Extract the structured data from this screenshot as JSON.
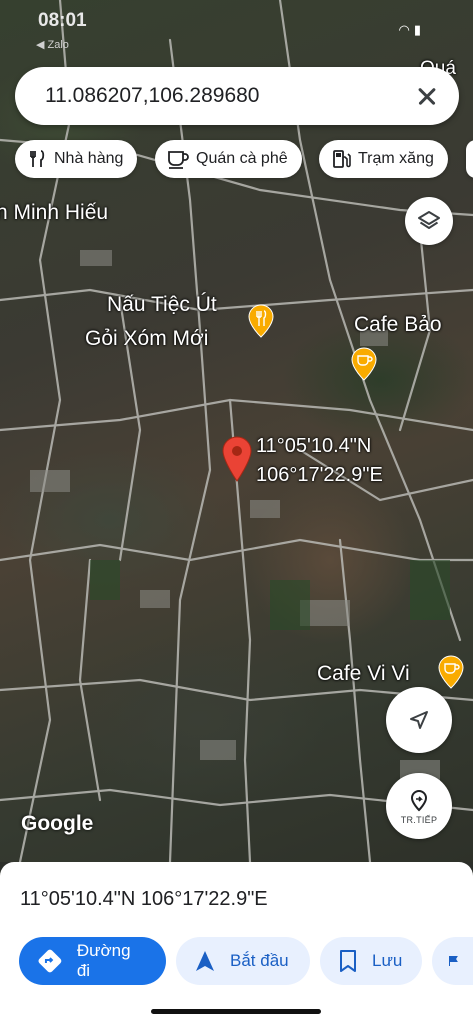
{
  "status": {
    "time": "08:01",
    "sub": "◀ Zalo"
  },
  "search": {
    "query": "11.086207,106.289680"
  },
  "chips": [
    {
      "label": "Nhà hàng",
      "icon": "restaurant-icon"
    },
    {
      "label": "Quán cà phê",
      "icon": "coffee-icon"
    },
    {
      "label": "Trạm xăng",
      "icon": "gas-station-icon"
    }
  ],
  "map": {
    "labels": {
      "minh_hieu": "n Minh Hiếu",
      "nau_tiec_line1": "Nấu Tiệc Út",
      "nau_tiec_line2": "Gỏi Xóm Mới",
      "cafe_bao": "Cafe Bảo",
      "cafe_vivi": "Cafe Vi Vi",
      "top_right": "Quá"
    },
    "pin_coords": {
      "lat": "11°05'10.4\"N",
      "lng": "106°17'22.9\"E"
    },
    "logo": "Google",
    "next_button_label": "TR.TIẾP"
  },
  "sheet": {
    "coords": "11°05'10.4\"N 106°17'22.9\"E",
    "actions": [
      {
        "label": "Đường đi",
        "icon": "directions-icon"
      },
      {
        "label": "Bắt đầu",
        "icon": "navigation-arrow-icon"
      },
      {
        "label": "Lưu",
        "icon": "bookmark-icon"
      }
    ]
  },
  "colors": {
    "accent": "#1a73e8",
    "pin": "#ea4335",
    "poi": "#f9ab00"
  }
}
